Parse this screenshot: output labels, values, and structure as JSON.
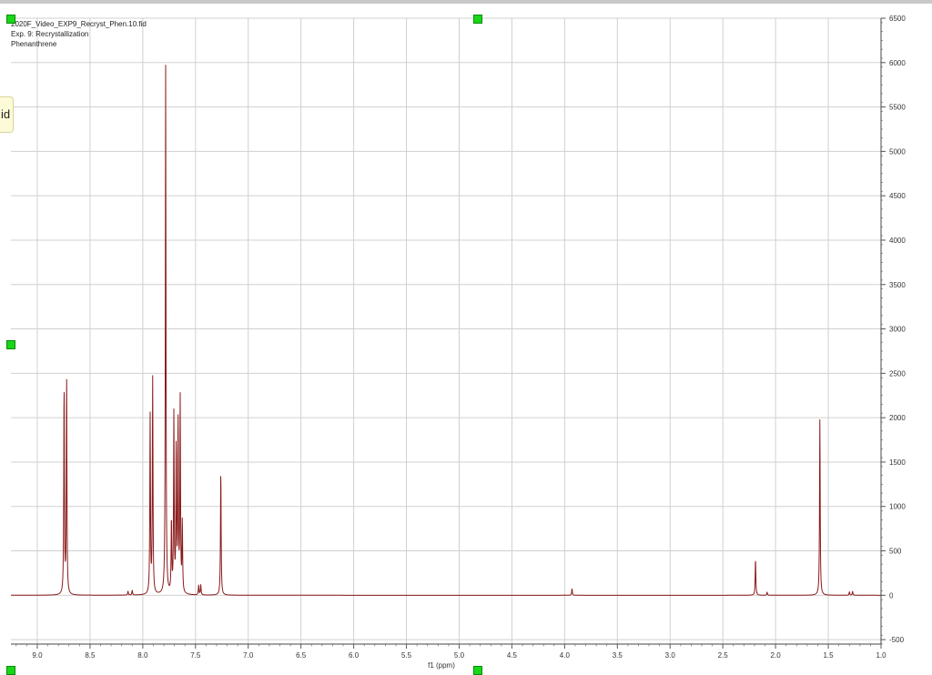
{
  "header": {
    "filename": "2020F_Video_EXP9_Recryst_Phen.10.fid",
    "experiment": "Exp. 9: Recrystallization",
    "compound": "Phenanthrene"
  },
  "side_tab": {
    "label": "id"
  },
  "chart_data": {
    "type": "line",
    "title": "",
    "xlabel": "f1 (ppm)",
    "ylabel": "",
    "x_reversed": true,
    "xlim": [
      9.25,
      1.0
    ],
    "ylim": [
      -550,
      6500
    ],
    "grid": true,
    "x_ticks": [
      9.0,
      8.5,
      8.0,
      7.5,
      7.0,
      6.5,
      6.0,
      5.5,
      5.0,
      4.5,
      4.0,
      3.5,
      3.0,
      2.5,
      2.0,
      1.5,
      1.0
    ],
    "x_tick_labels": [
      "9.0",
      "8.5",
      "8.0",
      "7.5",
      "7.0",
      "6.5",
      "6.0",
      "5.5",
      "5.0",
      "4.5",
      "4.0",
      "3.5",
      "3.0",
      "2.5",
      "2.0",
      "1.5",
      "1.0"
    ],
    "y_ticks": [
      -500,
      0,
      500,
      1000,
      1500,
      2000,
      2500,
      3000,
      3500,
      4000,
      4500,
      5000,
      5500,
      6000,
      6500
    ],
    "y_tick_labels": [
      "-500",
      "0",
      "500",
      "1000",
      "1500",
      "2000",
      "2500",
      "3000",
      "3500",
      "4000",
      "4500",
      "5000",
      "5500",
      "6000",
      "6500"
    ],
    "line_color": "#8b1a1a",
    "peaks": [
      {
        "ppm": 8.746,
        "height": 2360
      },
      {
        "ppm": 8.722,
        "height": 2450
      },
      {
        "ppm": 8.14,
        "height": 45
      },
      {
        "ppm": 8.1,
        "height": 55
      },
      {
        "ppm": 7.93,
        "height": 2030
      },
      {
        "ppm": 7.906,
        "height": 2430
      },
      {
        "ppm": 7.783,
        "height": 5960
      },
      {
        "ppm": 7.728,
        "height": 820
      },
      {
        "ppm": 7.705,
        "height": 2020
      },
      {
        "ppm": 7.683,
        "height": 1650
      },
      {
        "ppm": 7.665,
        "height": 1960
      },
      {
        "ppm": 7.645,
        "height": 2180
      },
      {
        "ppm": 7.625,
        "height": 790
      },
      {
        "ppm": 7.47,
        "height": 110
      },
      {
        "ppm": 7.45,
        "height": 120
      },
      {
        "ppm": 7.26,
        "height": 1420
      },
      {
        "ppm": 3.93,
        "height": 75
      },
      {
        "ppm": 2.19,
        "height": 410
      },
      {
        "ppm": 2.08,
        "height": 35
      },
      {
        "ppm": 1.58,
        "height": 2000
      },
      {
        "ppm": 1.3,
        "height": 40
      },
      {
        "ppm": 1.27,
        "height": 45
      }
    ]
  }
}
